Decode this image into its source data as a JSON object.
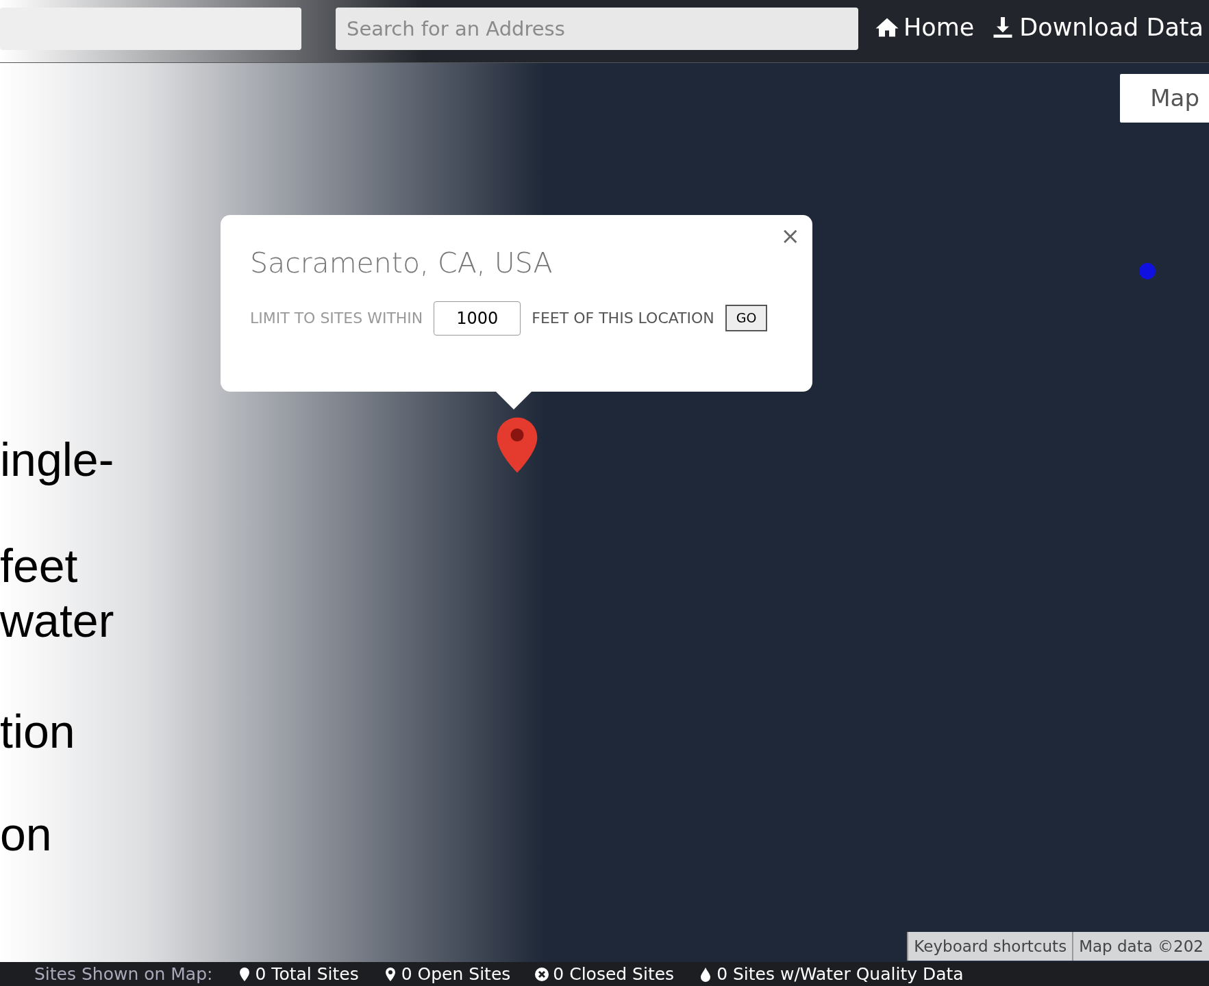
{
  "top_bar": {
    "address_search": {
      "placeholder": "Search for an Address"
    },
    "nav_links": [
      {
        "label": "Home",
        "kind": "home"
      },
      {
        "label": "Download Data",
        "kind": "download"
      }
    ]
  },
  "map": {
    "type_button": "Map",
    "popup": {
      "title": "Sacramento, CA, USA",
      "limit_prefix": "LIMIT TO SITES WITHIN",
      "distance": "1000",
      "limit_suffix": "FEET OF THIS LOCATION",
      "go_button": "GO",
      "close": "×"
    },
    "attribution": [
      "Keyboard shortcuts",
      "Map data ©202"
    ]
  },
  "overlay_text": [
    "ingle-",
    "feet",
    "water",
    "tion",
    "on"
  ],
  "status_bar": {
    "label": "Sites Shown on Map:",
    "counts": [
      {
        "kind": "pin",
        "text": "0 Total Sites"
      },
      {
        "kind": "open",
        "text": "0 Open Sites"
      },
      {
        "kind": "closed",
        "text": "0 Closed Sites"
      },
      {
        "kind": "drop",
        "text": "0 Sites w/Water Quality Data"
      }
    ]
  }
}
